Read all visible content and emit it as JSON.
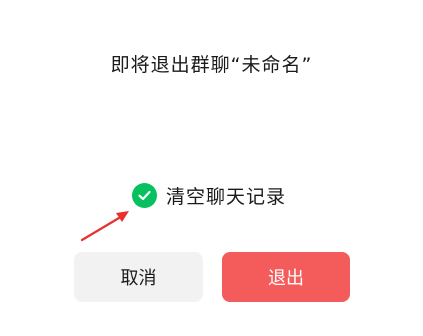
{
  "dialog": {
    "title": "即将退出群聊“未命名”",
    "option": {
      "label": "清空聊天记录",
      "checked": true,
      "check_color": "#07c160"
    },
    "annotation": {
      "icon": "red-arrow",
      "color": "#e8312f"
    },
    "buttons": {
      "cancel_label": "取消",
      "exit_label": "退出",
      "exit_color": "#f45b5b"
    }
  }
}
